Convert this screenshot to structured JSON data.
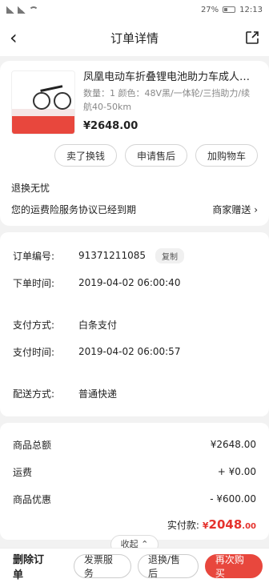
{
  "status_bar": {
    "left_text": "4G 4G",
    "battery": "27%",
    "time": "12:13"
  },
  "header": {
    "title": "订单详情"
  },
  "product": {
    "name": "凤凰电动车折叠锂电池助力车成人自…",
    "spec": "数量：1  颜色：48V黑/一体轮/三挡助力/续航40-50km",
    "price": "¥2648.00",
    "buttons": [
      "卖了换钱",
      "申请售后",
      "加购物车"
    ]
  },
  "return_section": {
    "title": "退换无忧",
    "desc": "您的运费险服务协议已经到期",
    "link": "商家赠送 ›"
  },
  "order_info": {
    "order_no_label": "订单编号:",
    "order_no": "91371211085",
    "copy_label": "复制",
    "order_time_label": "下单时间:",
    "order_time": "2019-04-02 06:00:40",
    "pay_method_label": "支付方式:",
    "pay_method": "白条支付",
    "pay_time_label": "支付时间:",
    "pay_time": "2019-04-02 06:00:57",
    "delivery_label": "配送方式:",
    "delivery": "普通快递"
  },
  "amounts": {
    "goods_total_label": "商品总额",
    "goods_total": "¥2648.00",
    "shipping_label": "运费",
    "shipping": "+ ¥0.00",
    "discount_label": "商品优惠",
    "discount": "- ¥600.00",
    "paid_label": "实付款:",
    "paid_yen": "¥",
    "paid_int": "2048",
    "paid_dec": ".00"
  },
  "collapse_label": "收起 ⌃",
  "bottom": {
    "delete": "删除订单",
    "invoice": "发票服务",
    "after_sale": "退换/售后",
    "rebuy": "再次购买"
  },
  "colors": {
    "accent": "#e5322d",
    "button_red": "#e8473d"
  }
}
